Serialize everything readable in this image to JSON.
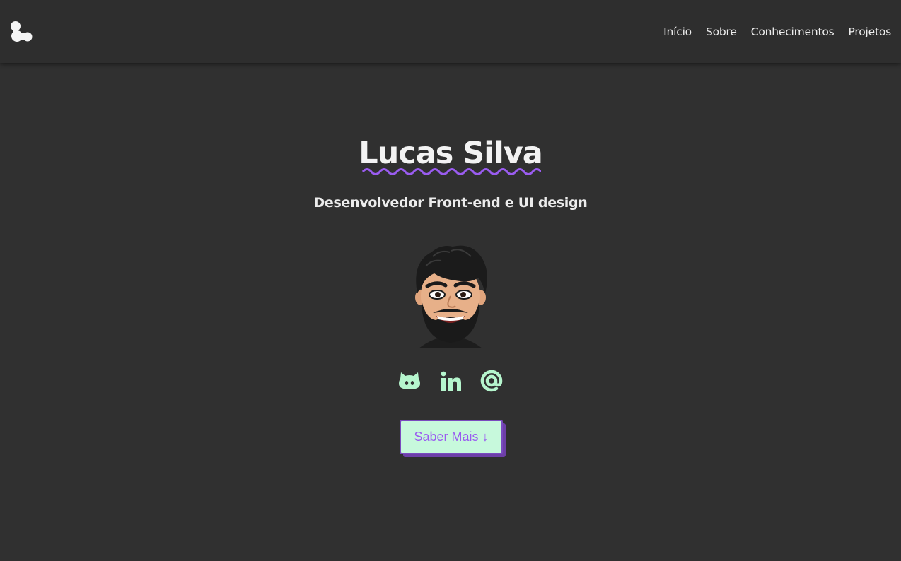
{
  "header": {
    "logo_icon": "brand-logo-icon",
    "nav": [
      {
        "label": "Início"
      },
      {
        "label": "Sobre"
      },
      {
        "label": "Conhecimentos"
      },
      {
        "label": "Projetos"
      }
    ]
  },
  "hero": {
    "name": "Lucas Silva",
    "role": "Desenvolvedor Front-end e UI design",
    "avatar_icon": "memoji-avatar",
    "socials": [
      {
        "icon": "github-icon"
      },
      {
        "icon": "linkedin-icon"
      },
      {
        "icon": "at-sign-icon"
      }
    ],
    "cta_label": "Saber Mais ↓"
  },
  "colors": {
    "background": "#303030",
    "header": "#2e2e2e",
    "accent_green": "#b5f5cd",
    "accent_purple": "#9a5cf0"
  }
}
